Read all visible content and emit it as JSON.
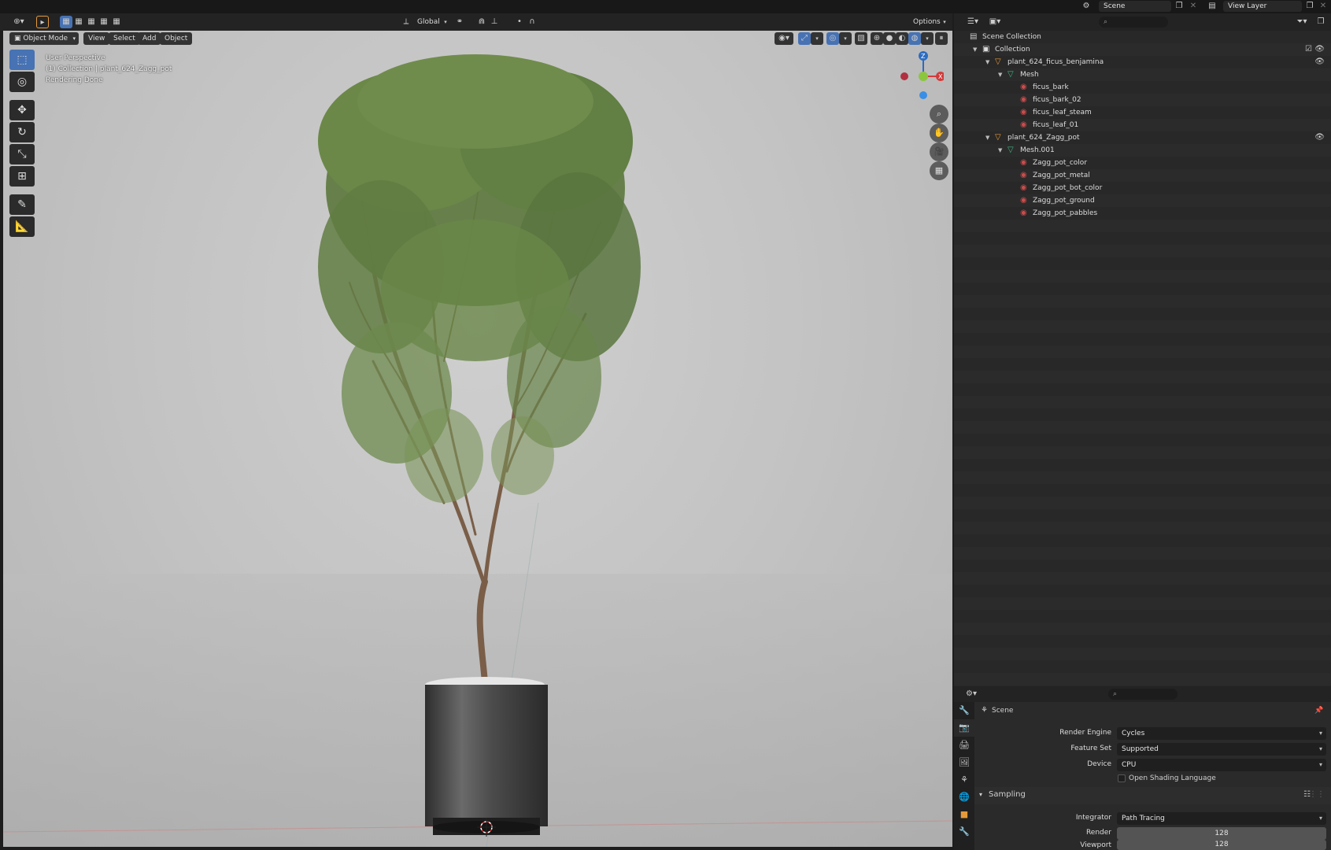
{
  "topbar": {
    "scene": "Scene",
    "view_layer": "View Layer"
  },
  "viewport_header": {
    "transform_orientation": "Global",
    "options": "Options",
    "mode": "Object Mode",
    "menus": [
      "View",
      "Select",
      "Add",
      "Object"
    ]
  },
  "viewport_info": [
    "User Perspective",
    "(1) Collection | plant_624_Zagg_pot",
    "Rendering Done"
  ],
  "gizmo": {
    "z": "Z",
    "x": "X"
  },
  "outliner": {
    "rows": [
      {
        "label": "Scene Collection",
        "indent": 0,
        "type": "scene"
      },
      {
        "label": "Collection",
        "indent": 1,
        "type": "collection"
      },
      {
        "label": "plant_624_ficus_benjamina",
        "indent": 2,
        "type": "object"
      },
      {
        "label": "Mesh",
        "indent": 3,
        "type": "mesh"
      },
      {
        "label": "ficus_bark",
        "indent": 4,
        "type": "material"
      },
      {
        "label": "ficus_bark_02",
        "indent": 4,
        "type": "material"
      },
      {
        "label": "ficus_leaf_steam",
        "indent": 4,
        "type": "material"
      },
      {
        "label": "ficus_leaf_01",
        "indent": 4,
        "type": "material"
      },
      {
        "label": "plant_624_Zagg_pot",
        "indent": 2,
        "type": "object"
      },
      {
        "label": "Mesh.001",
        "indent": 3,
        "type": "mesh"
      },
      {
        "label": "Zagg_pot_color",
        "indent": 4,
        "type": "material"
      },
      {
        "label": "Zagg_pot_metal",
        "indent": 4,
        "type": "material"
      },
      {
        "label": "Zagg_pot_bot_color",
        "indent": 4,
        "type": "material"
      },
      {
        "label": "Zagg_pot_ground",
        "indent": 4,
        "type": "material"
      },
      {
        "label": "Zagg_pot_pabbles",
        "indent": 4,
        "type": "material"
      }
    ]
  },
  "properties": {
    "context": "Scene",
    "render_engine_label": "Render Engine",
    "render_engine": "Cycles",
    "feature_set_label": "Feature Set",
    "feature_set": "Supported",
    "device_label": "Device",
    "device": "CPU",
    "osl_label": "Open Shading Language",
    "sampling_label": "Sampling",
    "integrator_label": "Integrator",
    "integrator": "Path Tracing",
    "render_label": "Render",
    "render": "128",
    "viewport_label": "Viewport",
    "viewport": "128"
  },
  "colors": {
    "accent": "#4772b3",
    "object": "#e59a3a",
    "mesh": "#3cb881",
    "material": "#c94d4d"
  }
}
